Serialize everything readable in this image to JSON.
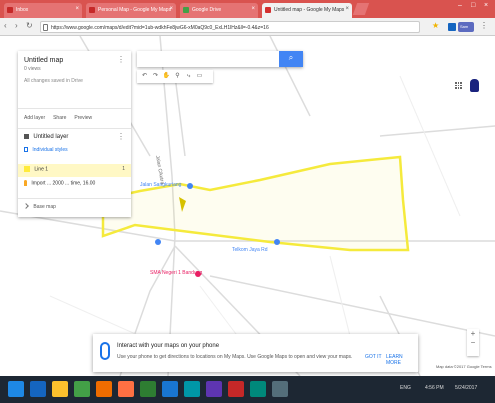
{
  "browser": {
    "tabs": [
      {
        "title": "Inbox"
      },
      {
        "title": "Personal Map - Google My Maps"
      },
      {
        "title": "Google Drive"
      },
      {
        "title": "Untitled map - Google My Maps"
      }
    ],
    "profile": "Sam",
    "url": "https://www.google.com/maps/d/edit?mid=1ub-wdkhFe8jwG6-xM0aQ9c0_ExLH1lHz&ll=-0.4&z=16"
  },
  "panel": {
    "map_title": "Untitled map",
    "map_subtitle": "0 views",
    "map_edited": "All changes saved in Drive",
    "actions": [
      "Add layer",
      "Share",
      "Preview"
    ],
    "layer_title": "Untitled layer",
    "layer_style": "Individual styles",
    "features": [
      {
        "label": "Line 1",
        "count": "1"
      },
      {
        "label": "Import ... 2000 ... time, 16.00"
      }
    ],
    "base_map": "Base map"
  },
  "map": {
    "search_icon": "search-icon",
    "tools": [
      "undo-icon",
      "redo-icon",
      "hand-icon",
      "marker-icon",
      "polyline-icon",
      "directions-icon",
      "ruler-icon"
    ],
    "labels": [
      {
        "text": "Jalan Sangkuriang"
      },
      {
        "text": "Telkom Jaya Rd"
      },
      {
        "text": "Jalan Cikutra"
      },
      {
        "text": "SMA Negeri 1 Bandung"
      }
    ],
    "zoom_in": "+",
    "zoom_out": "−",
    "attribution": "Map data ©2017 Google   Terms",
    "polygon_color": "#f5ea3c"
  },
  "banner": {
    "title": "Interact with your maps on your phone",
    "text": "Use your phone to get directions to locations on My Maps. Use Google Maps to open and view your maps.",
    "link_1": "GOT IT",
    "link_2": "LEARN MORE"
  },
  "taskbar": {
    "time": "4:56 PM",
    "date": "5/24/2017",
    "lang": "ENG"
  }
}
